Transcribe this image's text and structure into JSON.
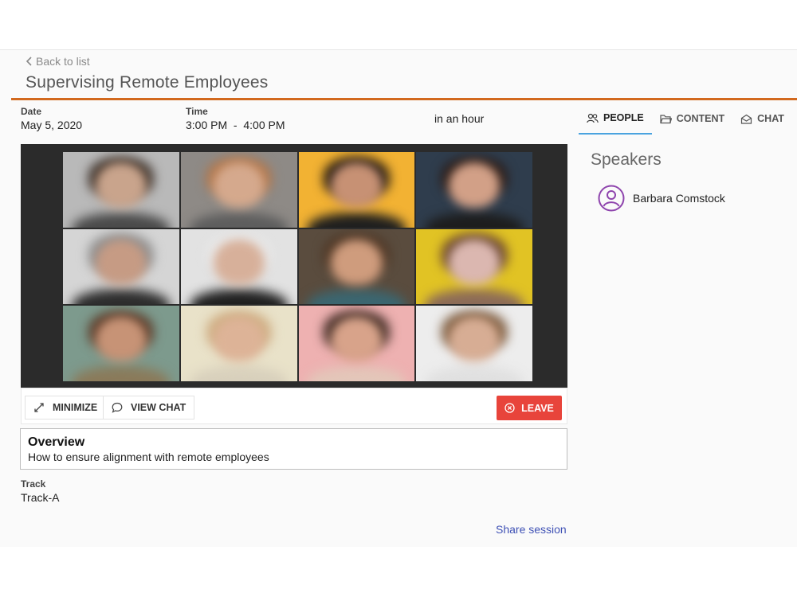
{
  "header": {
    "back_label": "Back to list",
    "title": "Supervising Remote Employees"
  },
  "session": {
    "date_label": "Date",
    "date_value": "May 5, 2020",
    "time_label": "Time",
    "time_value": "3:00 PM  -  4:00 PM",
    "relative_time": "in an hour",
    "track_label": "Track",
    "track_value": "Track-A"
  },
  "tabs": [
    {
      "label": "PEOPLE",
      "icon": "people-icon",
      "active": true
    },
    {
      "label": "CONTENT",
      "icon": "folder-icon",
      "active": false
    },
    {
      "label": "CHAT",
      "icon": "chat-envelope-icon",
      "active": false
    }
  ],
  "speakers": {
    "title": "Speakers",
    "items": [
      {
        "name": "Barbara Comstock",
        "icon": "user-circle-icon"
      }
    ]
  },
  "video": {
    "participants": [
      {
        "bg": "#b9b9b9",
        "face": "#c9a48c",
        "hair": "#3a2e26",
        "body": "#4a4a4a"
      },
      {
        "bg": "#8e8a86",
        "face": "#d5a98d",
        "hair": "#b4774a",
        "body": "#5d5d5d"
      },
      {
        "bg": "#f2b233",
        "face": "#c79174",
        "hair": "#1e1612",
        "body": "#1f1f1f"
      },
      {
        "bg": "#2f3d4d",
        "face": "#d2a087",
        "hair": "#2a1a14",
        "body": "#1d1d1d"
      },
      {
        "bg": "#d5d5d5",
        "face": "#c69b84",
        "hair": "#8d8d8d",
        "body": "#2d2d2d"
      },
      {
        "bg": "#e2e2e2",
        "face": "#d7b09a",
        "hair": "#e9e9e9",
        "body": "#202020"
      },
      {
        "bg": "#5a4c3e",
        "face": "#cf9c7d",
        "hair": "#4e3624",
        "body": "#3b6670"
      },
      {
        "bg": "#e1c324",
        "face": "#dbb7b0",
        "hair": "#6b4632",
        "body": "#8c6b57"
      },
      {
        "bg": "#7d9a8d",
        "face": "#c79376",
        "hair": "#5a3a28",
        "body": "#8a7a5a"
      },
      {
        "bg": "#e9e2c9",
        "face": "#ddb397",
        "hair": "#cfae83",
        "body": "#d8d0bc"
      },
      {
        "bg": "#eeb1b1",
        "face": "#d8a38a",
        "hair": "#3b2720",
        "body": "#e3c6b9"
      },
      {
        "bg": "#ededed",
        "face": "#d7ad94",
        "hair": "#7c5a3c",
        "body": "#e0e0e0"
      }
    ]
  },
  "controls": {
    "minimize_label": "MINIMIZE",
    "view_chat_label": "VIEW CHAT",
    "leave_label": "LEAVE",
    "leave_color": "#e8443b"
  },
  "overview": {
    "title": "Overview",
    "text": "How to ensure alignment with remote employees"
  },
  "share_label": "Share session",
  "colors": {
    "accent_rule": "#d2691e",
    "tab_active": "#4aa3df",
    "speaker_icon": "#8e44ad",
    "link": "#3f51b5"
  }
}
